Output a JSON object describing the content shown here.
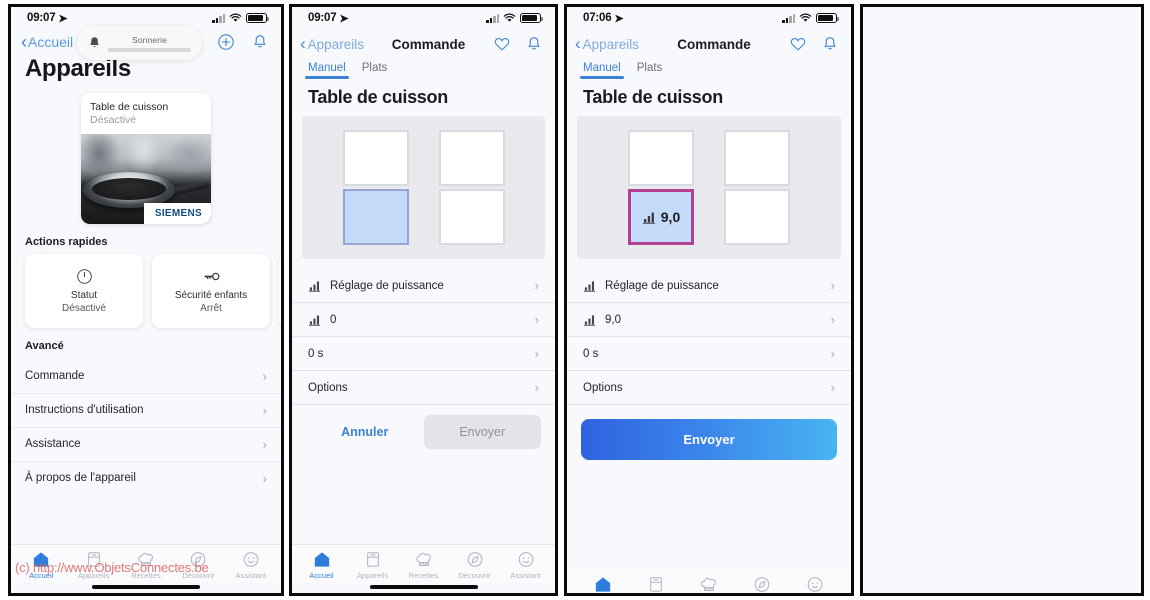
{
  "watermark": "(c) http://www.ObjetsConnectes.be",
  "panel1": {
    "status": {
      "time": "09:07",
      "location_icon": "location-arrow-icon",
      "signal_icon": "cellular-signal-icon",
      "wifi_icon": "wifi-icon",
      "battery_icon": "battery-icon"
    },
    "nav": {
      "back_label": "Accueil",
      "add_icon": "plus-circle-icon",
      "bell_icon": "bell-icon"
    },
    "ringer_hud": {
      "label": "Sonnerie",
      "bell_icon": "bell-icon",
      "level_percent": 65
    },
    "page_title": "Appareils",
    "device_card": {
      "name": "Table de cuisson",
      "state": "Désactivé",
      "brand": "SIEMENS"
    },
    "quick_actions_title": "Actions rapides",
    "quick_actions": [
      {
        "icon": "power-icon",
        "label": "Statut",
        "value": "Désactivé"
      },
      {
        "icon": "key-icon",
        "label": "Sécurité enfants",
        "value": "Arrêt"
      },
      {
        "icon": "partial-icon",
        "label": "",
        "value": ""
      }
    ],
    "advanced_title": "Avancé",
    "advanced_rows": [
      "Commande",
      "Instructions d'utilisation",
      "Assistance",
      "À propos de l'appareil"
    ],
    "tabbar": [
      {
        "icon": "home-icon",
        "label": "Accueil",
        "active": true
      },
      {
        "icon": "appliance-icon",
        "label": "Appareils",
        "active": false
      },
      {
        "icon": "chef-hat-icon",
        "label": "Recettes",
        "active": false
      },
      {
        "icon": "compass-icon",
        "label": "Découvrir",
        "active": false
      },
      {
        "icon": "assistant-face-icon",
        "label": "Assistant",
        "active": false
      }
    ]
  },
  "panel2": {
    "status": {
      "time": "09:07"
    },
    "nav": {
      "back_label": "Appareils",
      "title": "Commande",
      "heart_icon": "heart-icon",
      "bell_icon": "bell-icon"
    },
    "tabs": [
      {
        "label": "Manuel",
        "active": true
      },
      {
        "label": "Plats",
        "active": false
      }
    ],
    "title": "Table de cuisson",
    "hob": {
      "zones": [
        {
          "position": "top-left",
          "selected": false,
          "value": ""
        },
        {
          "position": "bottom-left",
          "selected": true,
          "value": ""
        },
        {
          "position": "top-right",
          "selected": false,
          "value": ""
        },
        {
          "position": "bottom-right",
          "selected": false,
          "value": ""
        }
      ]
    },
    "rows": [
      {
        "icon": "bar-chart-icon",
        "label": "Réglage de puissance"
      },
      {
        "icon": "bar-chart-icon",
        "label": "0"
      },
      {
        "icon": "",
        "label": "0 s"
      },
      {
        "icon": "",
        "label": "Options"
      }
    ],
    "cancel_label": "Annuler",
    "send_label": "Envoyer",
    "tabbar": [
      {
        "icon": "home-icon",
        "label": "Accueil",
        "active": true
      },
      {
        "icon": "appliance-icon",
        "label": "Appareils",
        "active": false
      },
      {
        "icon": "chef-hat-icon",
        "label": "Recettes",
        "active": false
      },
      {
        "icon": "compass-icon",
        "label": "Découvrir",
        "active": false
      },
      {
        "icon": "assistant-face-icon",
        "label": "Assistant",
        "active": false
      }
    ]
  },
  "panel3": {
    "status": {
      "time": "07:06"
    },
    "nav": {
      "back_label": "Appareils",
      "title": "Commande",
      "heart_icon": "heart-icon",
      "bell_icon": "bell-icon"
    },
    "tabs": [
      {
        "label": "Manuel",
        "active": true
      },
      {
        "label": "Plats",
        "active": false
      }
    ],
    "title": "Table de cuisson",
    "hob": {
      "zones": [
        {
          "position": "top-left",
          "selected": false,
          "value": ""
        },
        {
          "position": "bottom-left",
          "selected": true,
          "value": "9,0"
        },
        {
          "position": "top-right",
          "selected": false,
          "value": ""
        },
        {
          "position": "bottom-right",
          "selected": false,
          "value": ""
        }
      ],
      "selected_border_color": "#b43f8e",
      "selected_fill_color": "#c4daf9"
    },
    "rows": [
      {
        "icon": "bar-chart-icon",
        "label": "Réglage de puissance"
      },
      {
        "icon": "bar-chart-icon",
        "label": "9,0"
      },
      {
        "icon": "",
        "label": "0 s"
      },
      {
        "icon": "",
        "label": "Options"
      }
    ],
    "send_label": "Envoyer",
    "send_gradient": [
      "#2f63e0",
      "#48b4f2"
    ]
  },
  "panel4": {
    "empty": true
  }
}
